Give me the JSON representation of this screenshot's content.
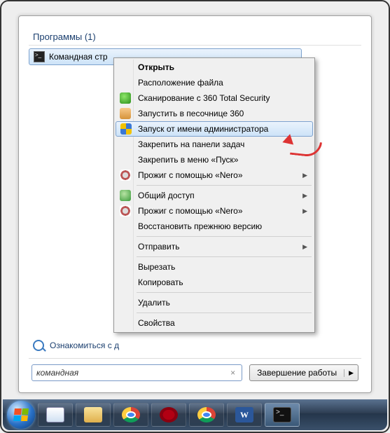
{
  "startmenu": {
    "group_header": "Программы (1)",
    "result_label": "Командная стр",
    "see_more": "Ознакомиться с д",
    "search_value": "командная",
    "shutdown_label": "Завершение работы"
  },
  "context_menu": {
    "open": "Открыть",
    "file_location": "Расположение файла",
    "scan_360": "Сканирование с 360 Total Security",
    "sandbox_360": "Запустить в песочнице 360",
    "run_as_admin": "Запуск от имени администратора",
    "pin_taskbar": "Закрепить на панели задач",
    "pin_start": "Закрепить в меню «Пуск»",
    "burn_nero": "Прожиг с помощью «Nero»",
    "sharing": "Общий доступ",
    "burn_nero2": "Прожиг с помощью «Nero»",
    "restore_prev": "Восстановить прежнюю версию",
    "send_to": "Отправить",
    "cut": "Вырезать",
    "copy": "Копировать",
    "delete": "Удалить",
    "properties": "Свойства"
  },
  "taskbar": {
    "items": [
      "start",
      "calc",
      "explorer",
      "chrome",
      "opera",
      "chrome2",
      "word",
      "cmd"
    ]
  }
}
